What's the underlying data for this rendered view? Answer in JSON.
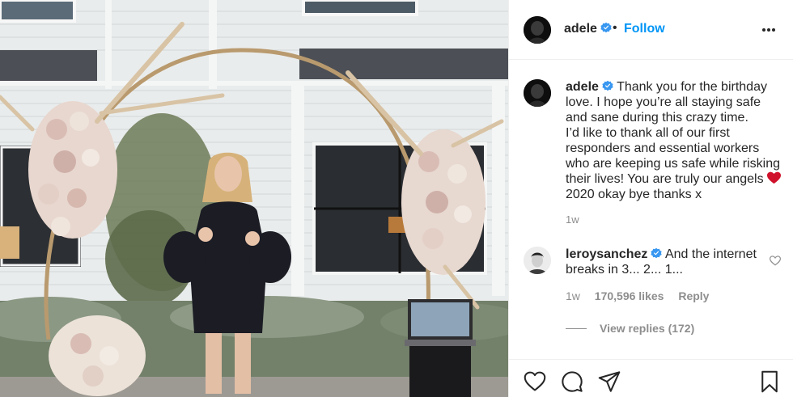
{
  "post": {
    "username": "adele",
    "verified": true,
    "separator": "•",
    "follow_label": "Follow",
    "more_icon": "more-options-icon"
  },
  "caption": {
    "username": "adele",
    "lines": [
      "Thank you for the birthday love. I hope you’re all staying safe and sane during this crazy time.",
      "I’d like to thank all of our first responders and essential workers who are keeping us safe while risking their lives! You are truly our angels",
      "2020 okay bye thanks x"
    ],
    "emoji": "red-heart",
    "time": "1w"
  },
  "comment": {
    "username": "leroysanchez",
    "verified": true,
    "text": "And the internet breaks in 3... 2... 1...",
    "time": "1w",
    "likes": "170,596 likes",
    "reply_label": "Reply",
    "view_replies": "View replies (172)"
  },
  "actions": {
    "like_icon": "heart-icon",
    "comment_icon": "comment-icon",
    "share_icon": "share-icon",
    "save_icon": "bookmark-icon"
  },
  "colors": {
    "link": "#0095f6",
    "verified": "#3897f0",
    "muted": "#8e8e8e",
    "text": "#262626"
  }
}
